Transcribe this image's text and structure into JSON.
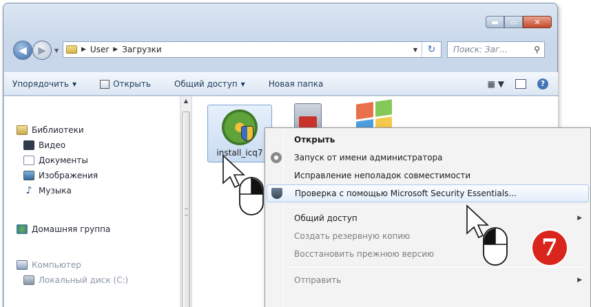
{
  "address_bar": {
    "path": [
      "User",
      "Загрузки"
    ],
    "search_placeholder": "Поиск: Заг..."
  },
  "toolbar": {
    "organize": "Упорядочить",
    "open": "Открыть",
    "share": "Общий доступ",
    "new_folder": "Новая папка"
  },
  "nav_pane": {
    "libraries": "Библиотеки",
    "video": "Видео",
    "documents": "Документы",
    "images": "Изображения",
    "music": "Музыка",
    "homegroup": "Домашняя группа",
    "computer": "Компьютер",
    "local_disk": "Локальный диск (C:)"
  },
  "files": {
    "selected_label": "install_icq7"
  },
  "context_menu": {
    "items": [
      "Открыть",
      "Запуск от имени администратора",
      "Исправление неполадок совместимости",
      "Проверка с помощью Microsoft Security Essentials...",
      "Общий доступ",
      "Создать резервную копию",
      "Восстановить прежнюю версию",
      "Отправить"
    ]
  },
  "step_badge": "7",
  "colors": {
    "badge": "#d9251c",
    "highlight_border": "#a9c8ea",
    "window_frame": "#c8d7ea"
  }
}
